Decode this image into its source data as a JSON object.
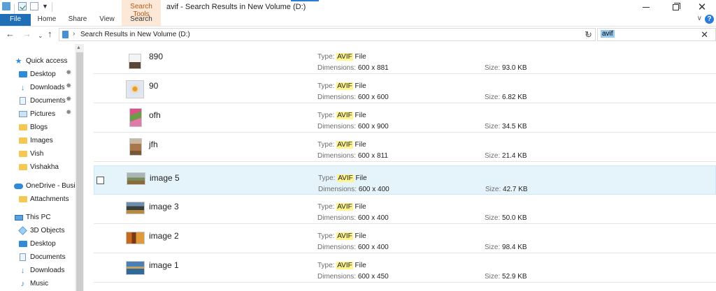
{
  "window": {
    "title": "avif - Search Results in New Volume (D:)",
    "context_tab_group": "Search Tools"
  },
  "ribbon": {
    "tabs": [
      {
        "label": "File"
      },
      {
        "label": "Home"
      },
      {
        "label": "Share"
      },
      {
        "label": "View"
      },
      {
        "label": "Search"
      }
    ]
  },
  "address": {
    "path": "Search Results in New Volume (D:)",
    "search_value": "avif"
  },
  "nav": {
    "items": [
      {
        "label": "Quick access",
        "icon": "star-icon"
      },
      {
        "label": "Desktop",
        "icon": "desktop-icon",
        "pinned": true
      },
      {
        "label": "Downloads",
        "icon": "download-icon",
        "pinned": true
      },
      {
        "label": "Documents",
        "icon": "document-icon",
        "pinned": true
      },
      {
        "label": "Pictures",
        "icon": "pictures-icon",
        "pinned": true
      },
      {
        "label": "Blogs",
        "icon": "folder-icon"
      },
      {
        "label": "Images",
        "icon": "folder-icon"
      },
      {
        "label": "Vish",
        "icon": "folder-icon"
      },
      {
        "label": "Vishakha",
        "icon": "folder-icon"
      },
      {
        "label": "OneDrive - Busin",
        "icon": "onedrive-icon"
      },
      {
        "label": "Attachments",
        "icon": "folder-icon"
      },
      {
        "label": "This PC",
        "icon": "this-pc-icon"
      },
      {
        "label": "3D Objects",
        "icon": "3d-objects-icon"
      },
      {
        "label": "Desktop",
        "icon": "desktop-icon"
      },
      {
        "label": "Documents",
        "icon": "document-icon"
      },
      {
        "label": "Downloads",
        "icon": "download-icon"
      },
      {
        "label": "Music",
        "icon": "music-icon"
      }
    ]
  },
  "labels": {
    "type": "Type:",
    "dimensions": "Dimensions:",
    "size": "Size:",
    "file_word": "File"
  },
  "results": [
    {
      "name": "890",
      "type": "AVIF",
      "dimensions": "600 x 881",
      "size": "93.0 KB",
      "thumb": "dark-stripe"
    },
    {
      "name": "90",
      "type": "AVIF",
      "dimensions": "600 x 600",
      "size": "6.82 KB",
      "thumb": "flower-square"
    },
    {
      "name": "ofh",
      "type": "AVIF",
      "dimensions": "600 x 900",
      "size": "34.5 KB",
      "thumb": "flowers-portrait"
    },
    {
      "name": "jfh",
      "type": "AVIF",
      "dimensions": "600 x 811",
      "size": "21.4 KB",
      "thumb": "cat-portrait"
    },
    {
      "name": "image 5",
      "type": "AVIF",
      "dimensions": "600 x 400",
      "size": "42.7 KB",
      "thumb": "landscape",
      "selected": true
    },
    {
      "name": "image 3",
      "type": "AVIF",
      "dimensions": "600 x 400",
      "size": "50.0 KB",
      "thumb": "mountains"
    },
    {
      "name": "image 2",
      "type": "AVIF",
      "dimensions": "600 x 400",
      "size": "98.4 KB",
      "thumb": "autumn"
    },
    {
      "name": "image 1",
      "type": "AVIF",
      "dimensions": "600 x 450",
      "size": "52.9 KB",
      "thumb": "lake"
    }
  ],
  "colors": {
    "accent": "#1f6fb8",
    "highlight": "#fff48e",
    "selection": "#e5f3fb",
    "context_tab": "#fde8d7"
  }
}
